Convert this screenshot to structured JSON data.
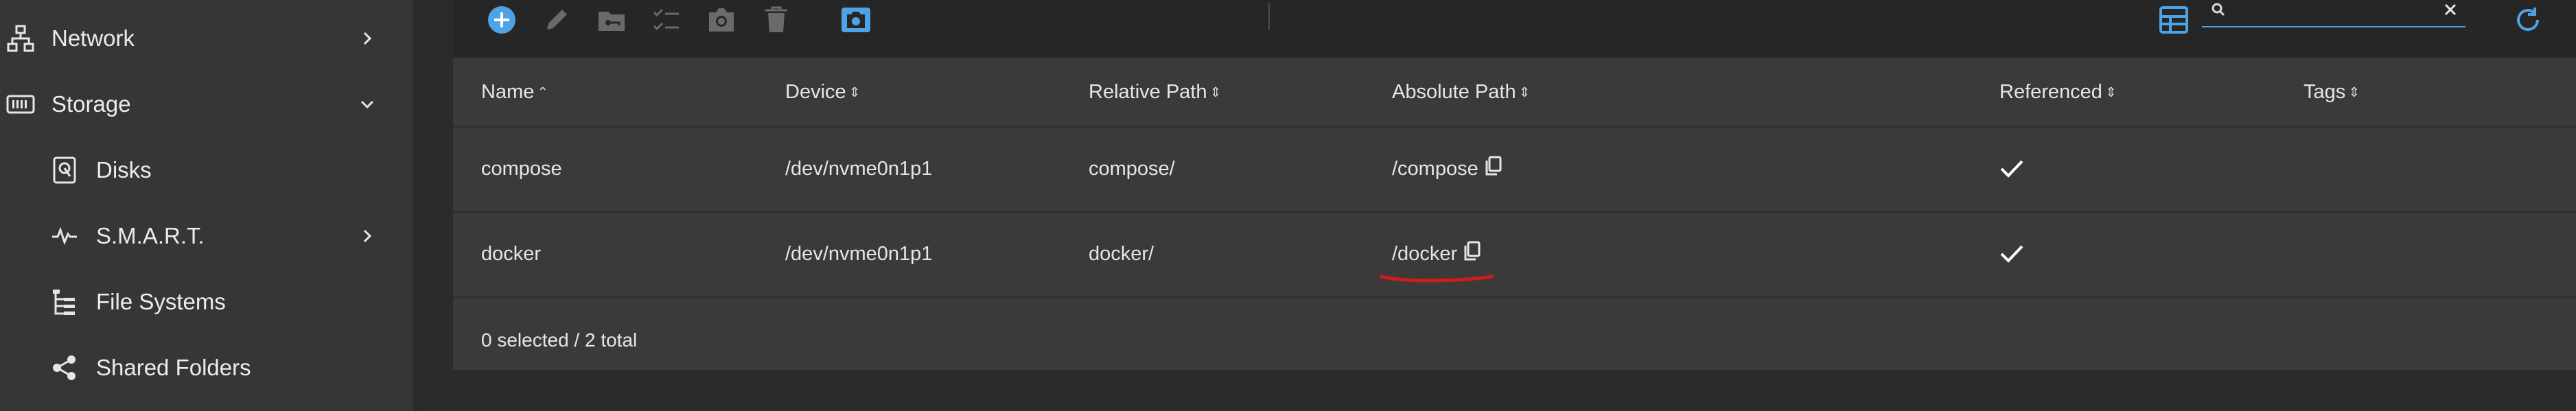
{
  "sidebar": {
    "items": [
      {
        "label": "Network",
        "icon": "network-icon",
        "chevron": "right"
      },
      {
        "label": "Storage",
        "icon": "storage-icon",
        "chevron": "down"
      },
      {
        "label": "Disks",
        "icon": "disk-icon"
      },
      {
        "label": "S.M.A.R.T.",
        "icon": "pulse-icon",
        "chevron": "right"
      },
      {
        "label": "File Systems",
        "icon": "filesystem-icon"
      },
      {
        "label": "Shared Folders",
        "icon": "share-icon"
      }
    ]
  },
  "toolbar": {
    "buttons": [
      "add-icon",
      "edit-icon",
      "folder-key-icon",
      "checklist-icon",
      "camera-icon",
      "delete-icon",
      "snapshot-icon"
    ],
    "search": {
      "value": "",
      "placeholder": ""
    }
  },
  "table": {
    "columns": [
      "Name",
      "Device",
      "Relative Path",
      "Absolute Path",
      "Referenced",
      "Tags"
    ],
    "rows": [
      {
        "name": "compose",
        "device": "/dev/nvme0n1p1",
        "relative_path": "compose/",
        "absolute_path": "/compose",
        "referenced": true,
        "tags": ""
      },
      {
        "name": "docker",
        "device": "/dev/nvme0n1p1",
        "relative_path": "docker/",
        "absolute_path": "/docker",
        "referenced": true,
        "tags": ""
      }
    ],
    "footer": "0 selected / 2 total"
  },
  "colors": {
    "accent": "#4ea3e6",
    "annotation": "#d11a1a"
  }
}
